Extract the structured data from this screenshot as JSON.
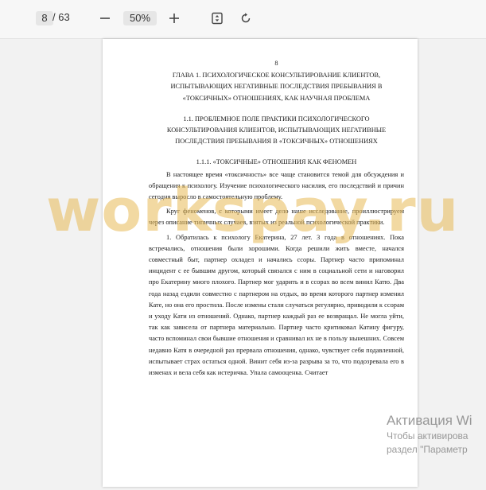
{
  "toolbar": {
    "current_page": "8",
    "page_separator": "/ 63",
    "zoom_out_icon": "minus-icon",
    "zoom_level": "50%",
    "zoom_in_icon": "plus-icon",
    "fit_icon": "fit-page-icon",
    "rotate_icon": "rotate-icon"
  },
  "document": {
    "page_number": "8",
    "chapter_heading": "ГЛАВА 1. ПСИХОЛОГИЧЕСКОЕ КОНСУЛЬТИРОВАНИЕ КЛИЕНТОВ, ИСПЫТЫВАЮЩИХ НЕГАТИВНЫЕ ПОСЛЕДСТВИЯ ПРЕБЫВАНИЯ В «ТОКСИЧНЫХ» ОТНОШЕНИЯХ, КАК НАУЧНАЯ ПРОБЛЕМА",
    "section_heading": "1.1.    ПРОБЛЕМНОЕ ПОЛЕ ПРАКТИКИ ПСИХОЛОГИЧЕСКОГО КОНСУЛЬТИРОВАНИЯ КЛИЕНТОВ, ИСПЫТЫВАЮЩИХ НЕГАТИВНЫЕ ПОСЛЕДСТВИЯ ПРЕБЫВАНИЯ В «ТОКСИЧНЫХ» ОТНОШЕНИЯХ",
    "subsection_heading": "1.1.1. «ТОКСИЧНЫЕ» ОТНОШЕНИЯ КАК ФЕНОМЕН",
    "paragraphs": [
      "В настоящее время «токсичность» все чаще становится темой для обсуждения и обращения к психологу. Изучение психологического насилия, его последствий и причин сегодня выросло в самостоятельную проблему.",
      "Круг феноменов, с которыми имеет дело наше исследование, проиллюстрируем через описание типичных случаев, взятых из реальной психологической практики.",
      "1. Обратилась к психологу Екатерина, 27 лет. 3 года в отношениях. Пока встречались, отношения были хорошими. Когда решили жить вместе, начался совместный быт, партнер охладел и начались ссоры. Партнер часто припоминал инцидент с ее бывшим другом, который связался с ним в социальной сети и наговорил про Екатерину много плохого. Партнер мог ударить и в ссорах во всем винил Катю. Два года назад ездили совместно с партнером на отдых, во время которого партнер изменил Кате, но она его простила. После измены стали случаться регулярно, приводили к ссорам и уходу Кати из отношений. Однако, партнер каждый раз ее возвращал. Не могла уйти, так как зависела от партнера материально. Партнер часто критиковал Катину фигуру, часто вспоминал свои бывшие отношения и сравнивал их не в пользу нынешних. Совсем недавно Катя в очередной раз прервала отношения, однако, чувствует себя подавленной, испытывает страх остаться одной. Винит себя из-за разрыва за то, что подозревала его в изменах и вела себя как истеричка. Упала самооценка. Считает"
    ]
  },
  "watermark": {
    "text": "workspay.ru",
    "color": "#e8b955"
  },
  "activation_notice": {
    "title": "Активация Wi",
    "line1": "Чтобы активирова",
    "line2": "раздел \"Параметр"
  }
}
